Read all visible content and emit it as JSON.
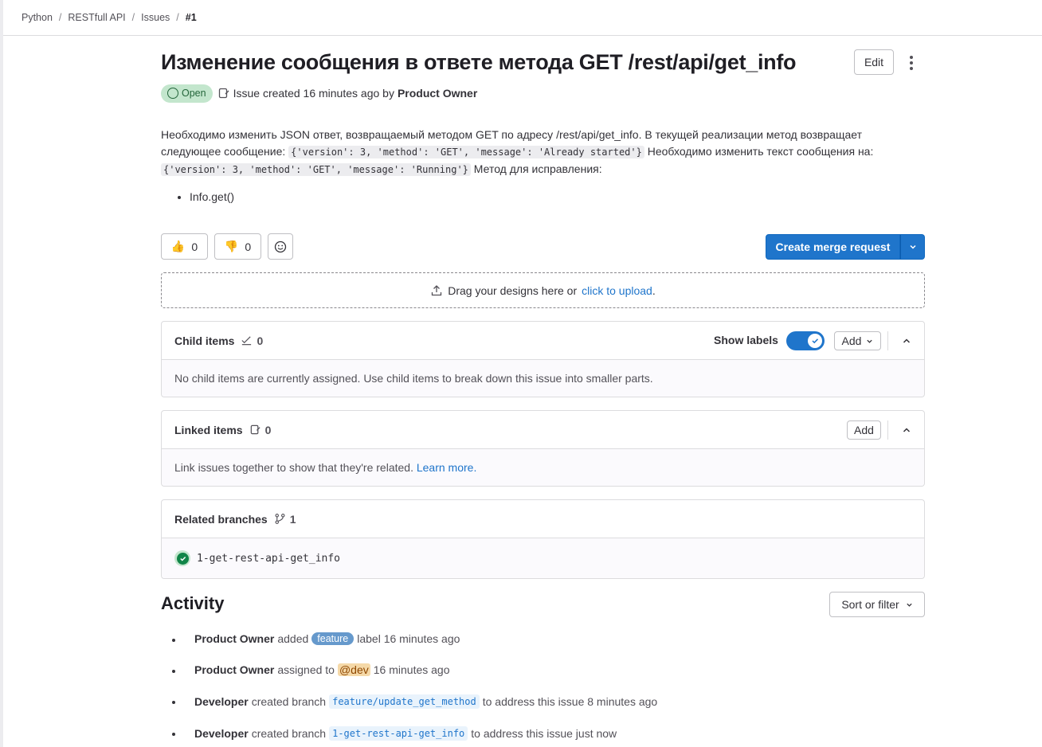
{
  "breadcrumb": [
    "Python",
    "RESTfull API",
    "Issues",
    "#1"
  ],
  "issue": {
    "title": "Изменение сообщения в ответе метода GET /rest/api/get_info",
    "edit_label": "Edit",
    "status": "Open",
    "created_text": "Issue created 16 minutes ago by",
    "author": "Product Owner"
  },
  "description": {
    "p1": "Необходимо изменить JSON ответ, возвращаемый методом GET по адресу /rest/api/get_info. В текущей реализации метод возвращает следующее сообщение:",
    "code1": "{'version': 3, 'method': 'GET', 'message': 'Already started'}",
    "p2": "Необходимо изменить текст сообщения на:",
    "code2": "{'version': 3, 'method': 'GET', 'message': 'Running'}",
    "p3": "Метод для исправления:",
    "bullets": [
      "Info.get()"
    ]
  },
  "reactions": {
    "thumbs_up_count": "0",
    "thumbs_down_count": "0"
  },
  "merge": {
    "label": "Create merge request"
  },
  "dropzone": {
    "text": "Drag your designs here or",
    "link": "click to upload",
    "suffix": "."
  },
  "child_items": {
    "title": "Child items",
    "count": "0",
    "show_labels": "Show labels",
    "show_labels_on": true,
    "add_label": "Add",
    "empty_text": "No child items are currently assigned. Use child items to break down this issue into smaller parts."
  },
  "linked_items": {
    "title": "Linked items",
    "count": "0",
    "add_label": "Add",
    "empty_text": "Link issues together to show that they're related.",
    "learn_more": "Learn more."
  },
  "related_branches": {
    "title": "Related branches",
    "count": "1",
    "branches": [
      "1-get-rest-api-get_info"
    ]
  },
  "activity": {
    "title": "Activity",
    "sort_label": "Sort or filter",
    "items": [
      {
        "actor": "Product Owner",
        "pre": "added",
        "label": "feature",
        "post": "label 16 minutes ago"
      },
      {
        "actor": "Product Owner",
        "pre": "assigned to",
        "mention": "@dev",
        "post": "16 minutes ago"
      },
      {
        "actor": "Developer",
        "pre": "created branch",
        "branch": "feature/update_get_method",
        "post": "to address this issue 8 minutes ago"
      },
      {
        "actor": "Developer",
        "pre": "created branch",
        "branch": "1-get-rest-api-get_info",
        "post": "to address this issue just now"
      }
    ]
  },
  "colors": {
    "primary": "#1f75cb",
    "open_badge_bg": "#c3e6cd",
    "open_badge_text": "#24663b",
    "feature_label": "#6699cc",
    "mention_bg": "#f5d9a8",
    "success": "#108548"
  }
}
